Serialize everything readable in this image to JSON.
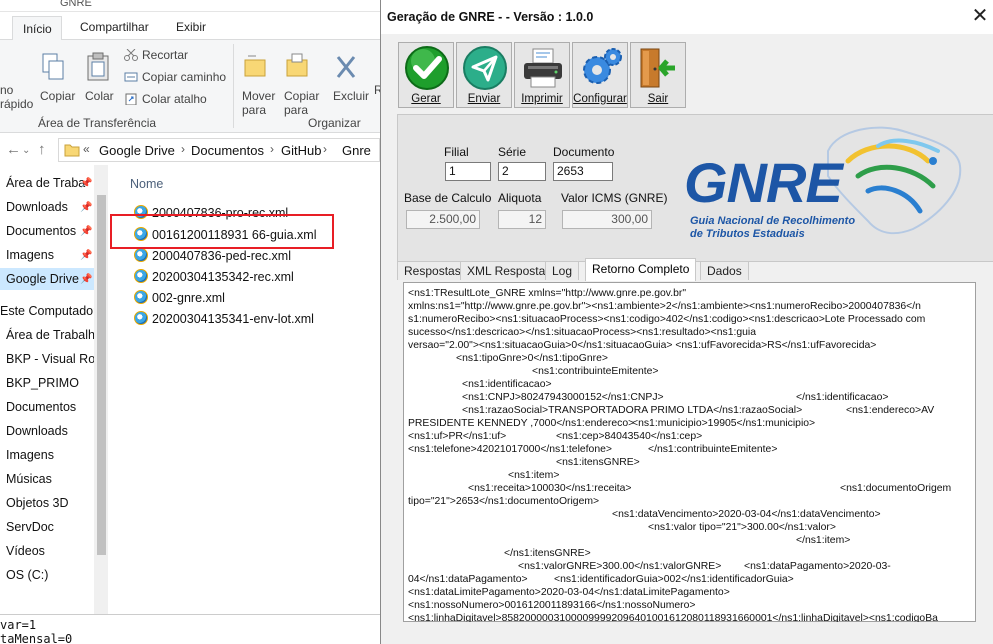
{
  "explorer": {
    "window_title": "GNRE",
    "tabs": [
      "Início",
      "Compartilhar",
      "Exibir"
    ],
    "ribbon": {
      "pin_label_1": "no",
      "pin_label_2": "rápido",
      "copy": "Copiar",
      "paste": "Colar",
      "cut": "Recortar",
      "copy_path": "Copiar caminho",
      "paste_shortcut": "Colar atalho",
      "group_clipboard": "Área de Transferência",
      "move_to_1": "Mover",
      "move_to_2": "para",
      "copy_to_1": "Copiar",
      "copy_to_2": "para",
      "delete": "Excluir",
      "rename_partial": "R",
      "group_organize": "Organizar"
    },
    "address": {
      "prefix": "«",
      "crumbs": [
        "Google Drive",
        "Documentos",
        "GitHub",
        "Gnre"
      ]
    },
    "nav_items": [
      "Área de Traba",
      "Downloads",
      "Documentos",
      "Imagens",
      "Google Drive",
      "Este Computador",
      "Área de Trabalho",
      "BKP - Visual Rod",
      "BKP_PRIMO",
      "Documentos",
      "Downloads",
      "Imagens",
      "Músicas",
      "Objetos 3D",
      "ServDoc",
      "Vídeos",
      "OS (C:)"
    ],
    "column_name": "Nome",
    "files": [
      "2000407836-pro-rec.xml",
      "00161200118931 66-guia.xml",
      "2000407836-ped-rec.xml",
      "20200304135342-rec.xml",
      "002-gnre.xml",
      "20200304135341-env-lot.xml"
    ],
    "code_lines": [
      "var=1",
      "taMensal=0"
    ]
  },
  "gnre": {
    "title": "Geração de GNRE -  - Versão : 1.0.0",
    "close": "✕",
    "buttons": {
      "gerar": "Gerar",
      "enviar": "Enviar",
      "imprimir": "Imprimir",
      "configurar": "Configurar",
      "sair": "Sair"
    },
    "fields": {
      "filial_label": "Filial",
      "filial": "1",
      "serie_label": "Série",
      "serie": "2",
      "documento_label": "Documento",
      "documento": "2653",
      "base_label": "Base de Calculo",
      "base": "2.500,00",
      "aliquota_label": "Aliquota",
      "aliquota": "12",
      "icms_label": "Valor ICMS (GNRE)",
      "icms": "300,00"
    },
    "logo": {
      "text": "GNRE",
      "line1": "Guia Nacional de Recolhimento",
      "line2": "de Tributos Estaduais"
    },
    "tabs": [
      "Respostas",
      "XML Respostas",
      "Log",
      "Retorno Completo",
      "Dados"
    ],
    "active_tab": "Retorno Completo",
    "xml_lines": [
      "<ns1:TResultLote_GNRE xmlns=\"http://www.gnre.pe.gov.br\"",
      "xmlns:ns1=\"http://www.gnre.pe.gov.br\"><ns1:ambiente>2</ns1:ambiente><ns1:numeroRecibo>2000407836</n",
      "s1:numeroRecibo><ns1:situacaoProcess><ns1:codigo>402</ns1:codigo><ns1:descricao>Lote Processado com",
      "sucesso</ns1:descricao></ns1:situacaoProcess><ns1:resultado><ns1:guia",
      "versao=\"2.00\"><ns1:situacaoGuia>0</ns1:situacaoGuia> <ns1:ufFavorecida>RS</ns1:ufFavorecida>",
      "<ns1:tipoGnre>0</ns1:tipoGnre>",
      "<ns1:contribuinteEmitente>",
      "<ns1:identificacao>",
      "<ns1:CNPJ>80247943000152</ns1:CNPJ>",
      "</ns1:identificacao>",
      "<ns1:razaoSocial>TRANSPORTADORA PRIMO LTDA</ns1:razaoSocial>",
      "<ns1:endereco>AV",
      "PRESIDENTE KENNEDY ,7000</ns1:endereco>",
      "<ns1:municipio>19905</ns1:municipio>",
      "<ns1:uf>PR</ns1:uf>",
      "<ns1:cep>84043540</ns1:cep>",
      "<ns1:telefone>42021017000</ns1:telefone>",
      "</ns1:contribuinteEmitente>",
      "<ns1:itensGNRE>",
      "<ns1:item>",
      "<ns1:receita>100030</ns1:receita>",
      "<ns1:documentoOrigem",
      "tipo=\"21\">2653</ns1:documentoOrigem>",
      "<ns1:dataVencimento>2020-03-04</ns1:dataVencimento>",
      "<ns1:valor tipo=\"21\">300.00</ns1:valor>",
      "</ns1:item>",
      "</ns1:itensGNRE>",
      "<ns1:valorGNRE>300.00</ns1:valorGNRE>",
      "<ns1:dataPagamento>2020-03-",
      "04</ns1:dataPagamento>",
      "<ns1:identificadorGuia>002</ns1:identificadorGuia>",
      "<ns1:dataLimitePagamento>2020-03-04</ns1:dataLimitePagamento>",
      "<ns1:nossoNumero>0016120011893166</ns1:nossoNumero>",
      "<ns1:linhaDigitavel>85820000031000099992096401001612080118931660001</ns1:linhaDigitavel><ns1:codigoBa"
    ]
  }
}
